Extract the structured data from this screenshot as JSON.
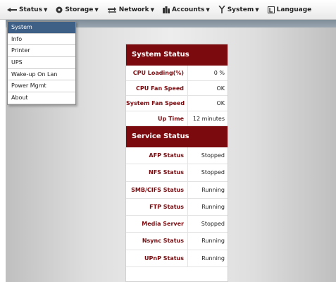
{
  "menubar": {
    "items": [
      {
        "label": "Status",
        "icon": "status-icon"
      },
      {
        "label": "Storage",
        "icon": "storage-icon"
      },
      {
        "label": "Network",
        "icon": "network-icon"
      },
      {
        "label": "Accounts",
        "icon": "accounts-icon"
      },
      {
        "label": "System",
        "icon": "system-icon"
      },
      {
        "label": "Language",
        "icon": "language-icon"
      }
    ]
  },
  "dropdown": {
    "items": [
      "System",
      "Info",
      "Printer",
      "UPS",
      "Wake-up On Lan",
      "Power Mgmt",
      "About"
    ],
    "selected": "System"
  },
  "system_status": {
    "title": "System Status",
    "rows": [
      {
        "label": "CPU Loading(%)",
        "value": "0 %"
      },
      {
        "label": "CPU Fan Speed",
        "value": "OK"
      },
      {
        "label": "System Fan Speed",
        "value": "OK"
      },
      {
        "label": "Up Time",
        "value": "12 minutes"
      }
    ]
  },
  "service_status": {
    "title": "Service Status",
    "rows": [
      {
        "label": "AFP Status",
        "value": "Stopped"
      },
      {
        "label": "NFS Status",
        "value": "Stopped"
      },
      {
        "label": "SMB/CIFS Status",
        "value": "Running"
      },
      {
        "label": "FTP Status",
        "value": "Running"
      },
      {
        "label": "Media Server",
        "value": "Stopped"
      },
      {
        "label": "Nsync Status",
        "value": "Running"
      },
      {
        "label": "UPnP Status",
        "value": "Running"
      }
    ]
  },
  "colors": {
    "header_red": "#7a0a0e",
    "dropdown_selected": "#3e5f86"
  }
}
